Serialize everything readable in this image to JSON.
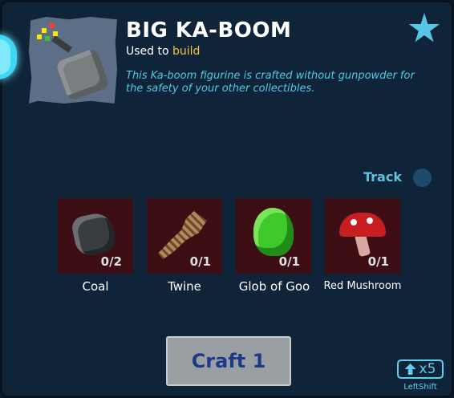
{
  "item": {
    "title": "BIG KA-BOOM",
    "used_to_prefix": "Used to",
    "used_to_action": "build",
    "description": "This Ka-boom figurine is crafted without gunpowder for the safety of your other collectibles."
  },
  "track": {
    "label": "Track",
    "enabled": false
  },
  "ingredients": [
    {
      "name": "Coal",
      "count": "0/2",
      "icon": "coal-icon"
    },
    {
      "name": "Twine",
      "count": "0/1",
      "icon": "twine-icon"
    },
    {
      "name": "Glob of Goo",
      "count": "0/1",
      "icon": "goo-icon"
    },
    {
      "name": "Red Mushroom",
      "count": "0/1",
      "icon": "mushroom-icon"
    }
  ],
  "craft": {
    "label": "Craft 1"
  },
  "multiplier": {
    "value": "x5",
    "key": "LeftShift"
  },
  "colors": {
    "accent": "#56c7e3",
    "highlight": "#f4c542",
    "ingredient_bg": "#3d0f15",
    "panel_bg": "#0f2439"
  }
}
